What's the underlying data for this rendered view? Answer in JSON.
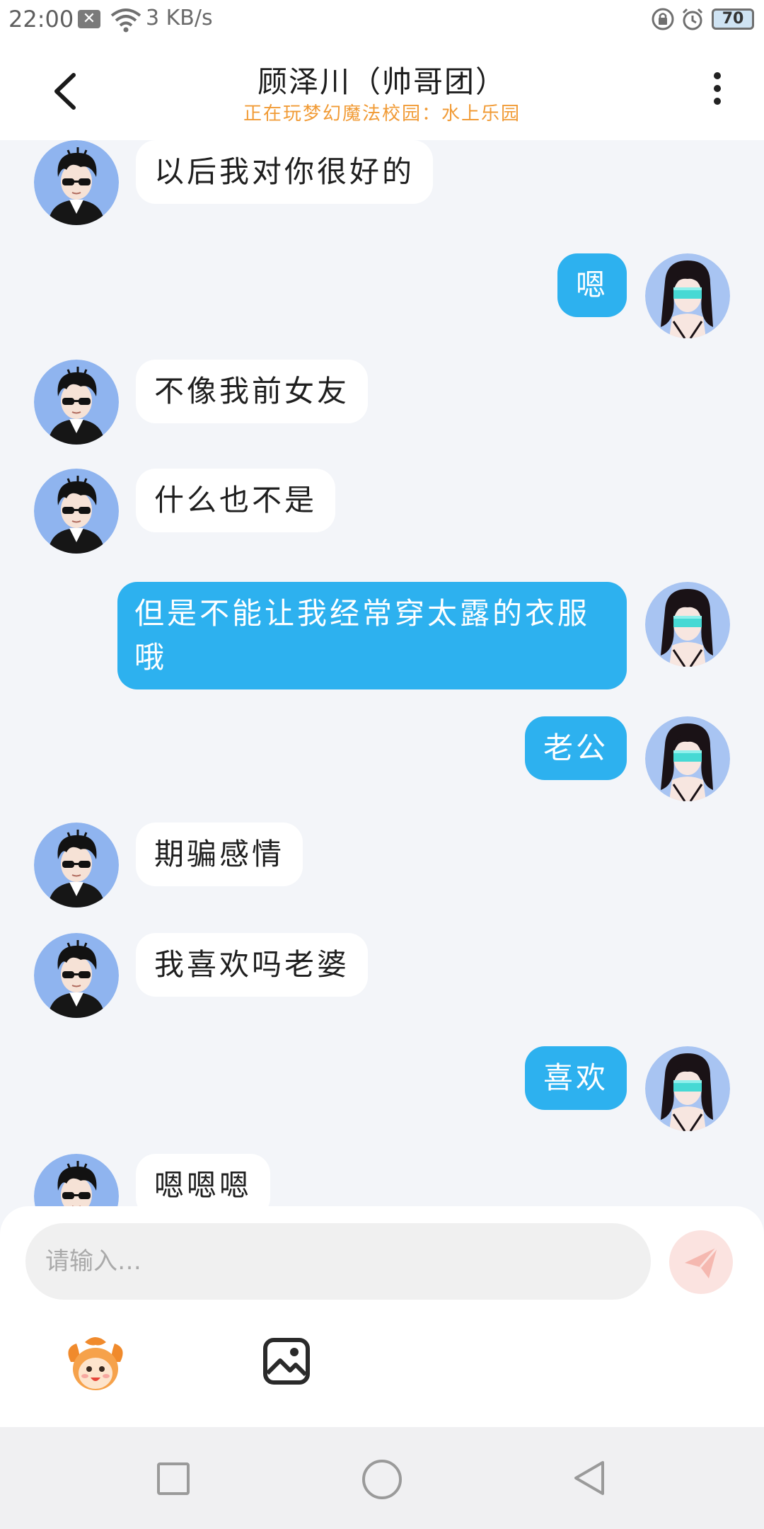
{
  "status_bar": {
    "time": "22:00",
    "notification_icon": "close-box-icon",
    "net_speed": "3 KB/s",
    "battery": "70"
  },
  "header": {
    "title": "顾泽川（帅哥团）",
    "subtitle": "正在玩梦幻魔法校园：水上乐园"
  },
  "messages": [
    {
      "side": "left",
      "text": "以后我对你很好的"
    },
    {
      "side": "right",
      "text": "嗯"
    },
    {
      "side": "left",
      "text": "不像我前女友"
    },
    {
      "side": "left",
      "text": "什么也不是"
    },
    {
      "side": "right",
      "text": "但是不能让我经常穿太露的衣服哦"
    },
    {
      "side": "right",
      "text": "老公"
    },
    {
      "side": "left",
      "text": "期骗感情"
    },
    {
      "side": "left",
      "text": "我喜欢吗老婆"
    },
    {
      "side": "right",
      "text": "喜欢"
    },
    {
      "side": "left",
      "text": "嗯嗯嗯"
    }
  ],
  "input": {
    "placeholder": "请输入…"
  },
  "colors": {
    "accent_blue": "#2db1ef",
    "subtitle_orange": "#f19b36",
    "background": "#f3f5f9"
  }
}
